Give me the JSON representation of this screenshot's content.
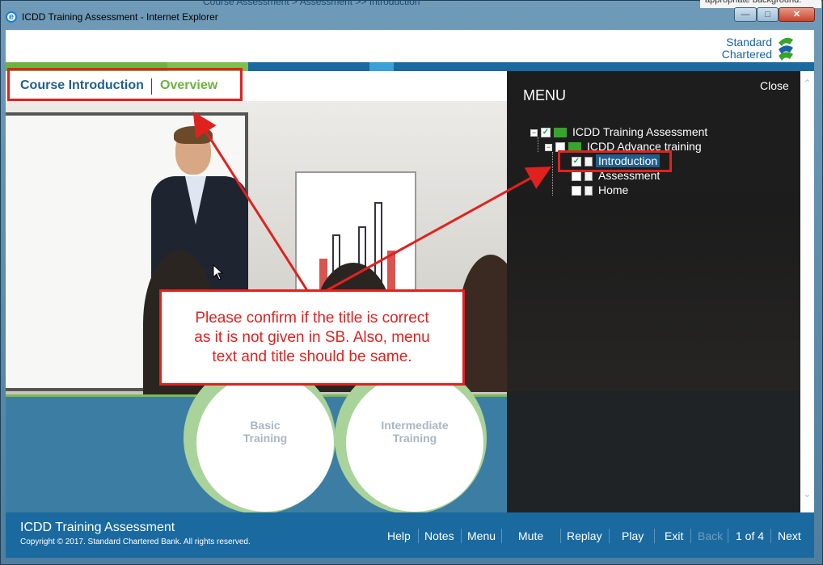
{
  "window": {
    "title": "ICDD Training Assessment - Internet Explorer",
    "background_text": "Course Assessment > Assessment >> Introduction",
    "background_side_text": "appropriate background."
  },
  "brand": {
    "name_line1": "Standard",
    "name_line2": "Chartered",
    "colors": {
      "blue": "#1a62a8",
      "green": "#37a52c"
    }
  },
  "header": {
    "course_title": "Course Introduction",
    "section_title": "Overview"
  },
  "training_cards": [
    {
      "line1": "Basic",
      "line2": "Training"
    },
    {
      "line1": "Intermediate",
      "line2": "Training"
    }
  ],
  "menu": {
    "title": "MENU",
    "close_label": "Close",
    "tree": {
      "root": "ICDD Training Assessment",
      "child": "ICDD Advance training",
      "items": [
        {
          "label": "Introduction",
          "checked": true,
          "selected": true
        },
        {
          "label": "Assessment",
          "checked": false,
          "selected": false
        },
        {
          "label": "Home",
          "checked": false,
          "selected": false
        }
      ]
    }
  },
  "footer": {
    "title": "ICDD Training Assessment",
    "copyright": "Copyright © 2017. Standard Chartered Bank. All rights reserved.",
    "buttons": {
      "help": "Help",
      "notes": "Notes",
      "menu": "Menu",
      "mute": "Mute",
      "replay": "Replay",
      "play": "Play",
      "exit": "Exit",
      "back": "Back",
      "page": "1 of 4",
      "next": "Next"
    }
  },
  "annotation": {
    "line1": "Please confirm if the title is correct",
    "line2": "as it is not given in SB. Also, menu",
    "line3": "text and title should be same.",
    "color": "#e0221f"
  }
}
